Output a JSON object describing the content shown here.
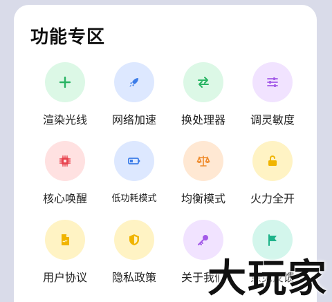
{
  "section": {
    "title": "功能专区"
  },
  "items": [
    {
      "label": "渲染光线",
      "icon": "plus-icon",
      "bg": "#dcf8e6",
      "fg": "#28b463"
    },
    {
      "label": "网络加速",
      "icon": "rocket-icon",
      "bg": "#dde8ff",
      "fg": "#3d7de8"
    },
    {
      "label": "换处理器",
      "icon": "swap-arrows-icon",
      "bg": "#dcf8e6",
      "fg": "#28b463"
    },
    {
      "label": "调灵敏度",
      "icon": "sliders-icon",
      "bg": "#f1e3ff",
      "fg": "#a35ae8"
    },
    {
      "label": "核心唤醒",
      "icon": "chip-icon",
      "bg": "#ffe1e1",
      "fg": "#e8444f"
    },
    {
      "label": "低功耗模式",
      "icon": "battery-icon",
      "bg": "#dde8ff",
      "fg": "#3d7de8"
    },
    {
      "label": "均衡模式",
      "icon": "scale-icon",
      "bg": "#ffe8d3",
      "fg": "#ef8a2a"
    },
    {
      "label": "火力全开",
      "icon": "unlock-icon",
      "bg": "#fff3c4",
      "fg": "#f0b400"
    },
    {
      "label": "用户协议",
      "icon": "document-icon",
      "bg": "#fff3c4",
      "fg": "#f0b400"
    },
    {
      "label": "隐私政策",
      "icon": "shield-icon",
      "bg": "#fff3c4",
      "fg": "#f0b400"
    },
    {
      "label": "关于我们",
      "icon": "key-icon",
      "bg": "#f1e3ff",
      "fg": "#a35ae8"
    },
    {
      "label": "意见反馈",
      "icon": "flag-icon",
      "bg": "#d3f6ec",
      "fg": "#1fb38a"
    }
  ],
  "watermark": "大玩家"
}
